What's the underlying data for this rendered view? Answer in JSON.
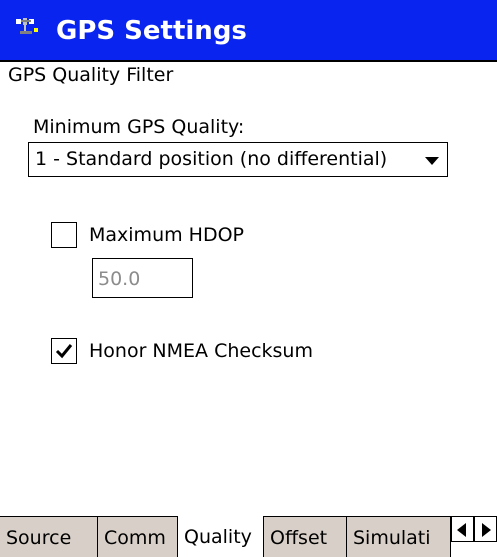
{
  "window": {
    "title": "GPS Settings",
    "titlebar_color": "#0a24f0",
    "icon": "satellite-antenna-icon"
  },
  "form": {
    "section_title": "GPS Quality Filter",
    "min_quality_label": "Minimum GPS Quality:",
    "min_quality_value": "1 - Standard position (no differential)",
    "max_hdop_label": "Maximum HDOP",
    "max_hdop_checked": false,
    "max_hdop_value": "50.0",
    "honor_checksum_label": "Honor NMEA Checksum",
    "honor_checksum_checked": true
  },
  "tabs": [
    {
      "label": "Source",
      "active": false
    },
    {
      "label": "Comm",
      "active": false
    },
    {
      "label": "Quality",
      "active": true
    },
    {
      "label": "Offset",
      "active": false
    },
    {
      "label": "Simulati",
      "active": false
    }
  ],
  "tab_scroll": {
    "left_icon": "scroll-left-icon",
    "right_icon": "scroll-right-icon"
  },
  "colors": {
    "tab_background": "#d8d0c8",
    "disabled_text": "#8c8c8c"
  }
}
